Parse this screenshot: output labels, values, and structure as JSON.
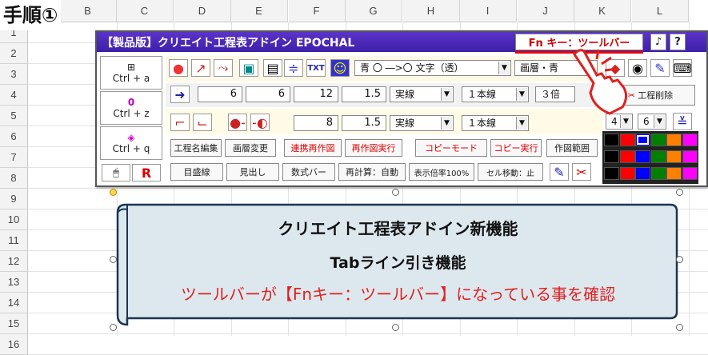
{
  "step_label": "手順①",
  "sheet": {
    "columns": [
      "B",
      "C",
      "D",
      "E",
      "F",
      "G",
      "H",
      "I",
      "J",
      "K",
      "L"
    ],
    "rows": [
      "1",
      "2",
      "3",
      "4",
      "5",
      "6",
      "7",
      "8",
      "9",
      "10",
      "11",
      "12",
      "13",
      "14",
      "15",
      "16"
    ]
  },
  "toolbar": {
    "title": "【製品版】クリエイト工程表アドイン EPOCHAL",
    "fn_key_label": "Fn キー：ツールバー",
    "music_icon": "♪",
    "help_label": "?",
    "left_buttons": [
      "Ctrl + a",
      "Ctrl + z",
      "Ctrl + q"
    ],
    "undo_glyph": "0",
    "row3": {
      "color_text": "青 〇 ―>〇 文字（透）",
      "layer_text": "画層・青"
    },
    "row4": {
      "values": [
        "6",
        "6",
        "12",
        "1.5"
      ],
      "line_type": "実線",
      "line_count": "１本線",
      "scale": "３倍",
      "erase_label": "工程削除"
    },
    "row5": {
      "values": [
        "8",
        "1.5"
      ],
      "line_type": "実線",
      "line_count": "１本線",
      "spin_a": "4",
      "spin_b": "6"
    },
    "row6_buttons": [
      "工程名編集",
      "画層変更",
      "連携再作図",
      "再作図実行",
      "コピーモード",
      "コピー実行",
      "作図範囲"
    ],
    "row7_buttons": [
      "目盛線",
      "見出し",
      "数式バー",
      "再計算：自動",
      "表示倍率100%",
      "セル移動：止"
    ],
    "palette": [
      [
        "#000000",
        "#ff0000",
        "#0000ff",
        "#008000",
        "#ff8000",
        "#ff00ff"
      ],
      [
        "#000000",
        "#ff0000",
        "#0000ff",
        "#008000",
        "#ff8000",
        "#ff00ff"
      ],
      [
        "#000000",
        "#ff0000",
        "#0000ff",
        "#008000",
        "#ff8000",
        "#ff00ff"
      ]
    ]
  },
  "banner": {
    "line1": "クリエイト工程表アドイン新機能",
    "line2": "Tabライン引き機能",
    "line3": "ツールバーが【Fnキー：ツールバー】になっている事を確認"
  }
}
